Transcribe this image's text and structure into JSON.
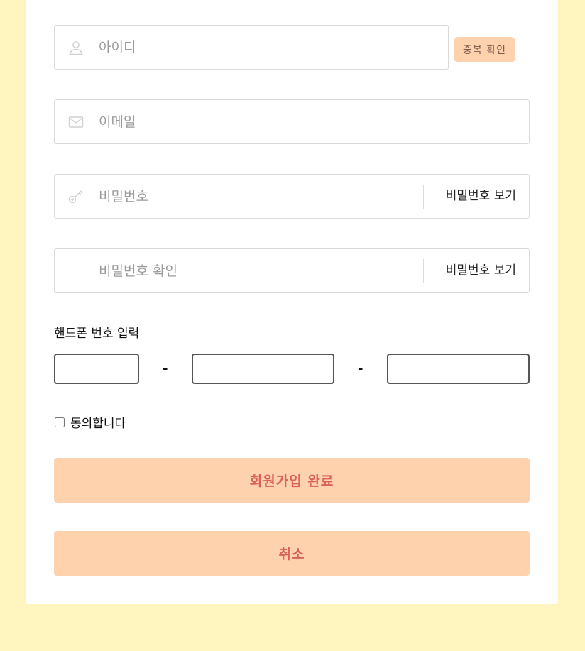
{
  "form": {
    "id_field": {
      "placeholder": "아이디",
      "icon": "user-icon"
    },
    "dup_check_label": "중복 확인",
    "email_field": {
      "placeholder": "이메일",
      "icon": "mail-icon"
    },
    "password_field": {
      "placeholder": "비밀번호",
      "icon": "key-icon",
      "show_label": "비밀번호 보기"
    },
    "password_confirm_field": {
      "placeholder": "비밀번호 확인",
      "show_label": "비밀번호 보기"
    },
    "phone": {
      "label": "핸드폰 번호 입력",
      "separator": "-",
      "part1": "",
      "part2": "",
      "part3": ""
    },
    "agree_label": "동의합니다",
    "agree_checked": false,
    "submit_label": "회원가입 완료",
    "cancel_label": "취소"
  },
  "colors": {
    "page_background": "#fff5bf",
    "card_background": "#ffffff",
    "button_background": "#ffd2ae",
    "button_text": "#d9615a",
    "divider": "#f6d2b6"
  }
}
